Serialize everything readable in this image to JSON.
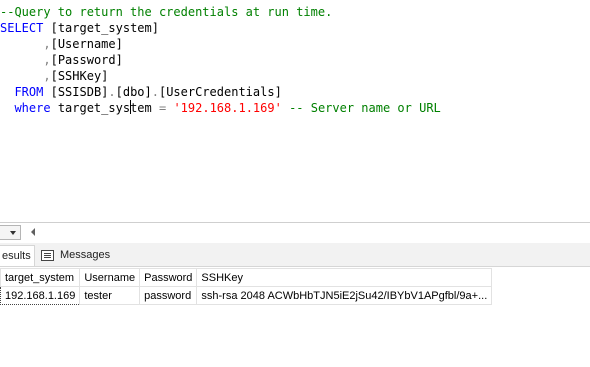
{
  "editor": {
    "comment": "--Query to return the credentials at run time.",
    "select_kw": "SELECT",
    "col1": "[target_system]",
    "comma": ",",
    "col2": "[Username]",
    "col3": "[Password]",
    "col4": "[SSHKey]",
    "from_kw": "FROM",
    "db": "[SSISDB]",
    "dot": ".",
    "schema": "[dbo]",
    "table": "[UserCredentials]",
    "where_kw": "where",
    "where_col_a": "target_sys",
    "where_col_b": "tem",
    "equals": "=",
    "value": "'192.168.1.169'",
    "trailing_comment": "-- Server name or URL"
  },
  "results": {
    "tabs": [
      {
        "label": "esults"
      },
      {
        "label": "Messages"
      }
    ],
    "columns": [
      "target_system",
      "Username",
      "Password",
      "SSHKey"
    ],
    "rows": [
      [
        "192.168.1.169",
        "tester",
        "password",
        "ssh-rsa 2048 ACWbHbTJN5iE2jSu42/IBYbV1APgfbl/9a+..."
      ]
    ]
  },
  "icons": {
    "zoom_dropdown": "chevron-down-icon",
    "scroll_left": "scroll-left-arrow-icon",
    "messages": "messages-icon"
  },
  "colors": {
    "keyword": "#0000ff",
    "comment": "#008000",
    "string": "#ff0000",
    "operator": "#808080"
  }
}
